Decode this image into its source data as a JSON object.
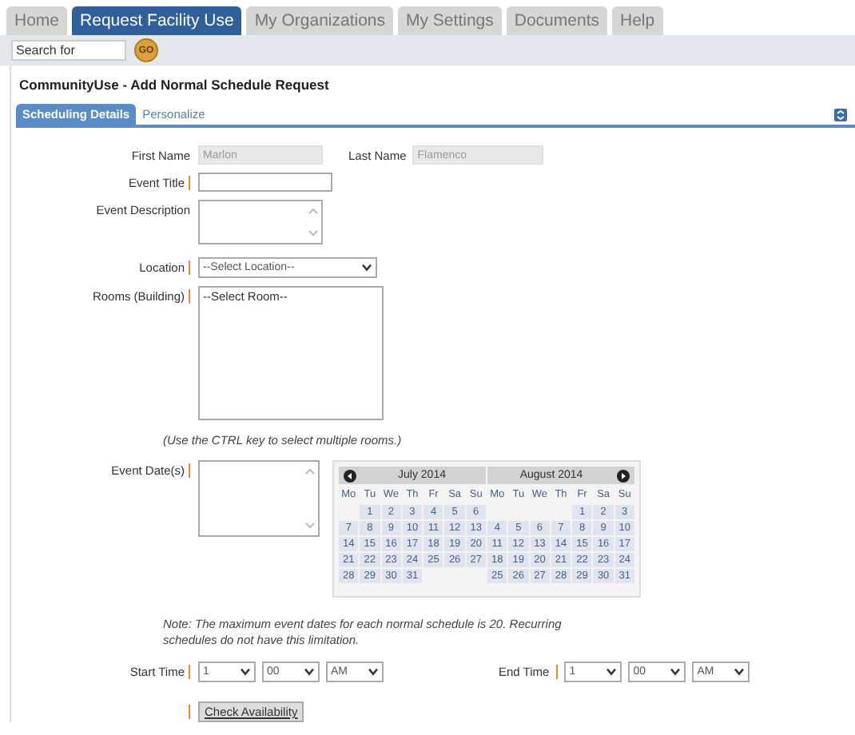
{
  "nav_tabs": [
    {
      "label": "Home",
      "selected": false
    },
    {
      "label": "Request Facility Use",
      "selected": true
    },
    {
      "label": "My Organizations",
      "selected": false
    },
    {
      "label": "My Settings",
      "selected": false
    },
    {
      "label": "Documents",
      "selected": false
    },
    {
      "label": "Help",
      "selected": false
    }
  ],
  "search": {
    "placeholder": "Search for",
    "button": "GO"
  },
  "page_title": "CommunityUse - Add Normal Schedule Request",
  "sub_tabs": [
    {
      "label": "Scheduling Details",
      "selected": true
    },
    {
      "label": "Personalize",
      "selected": false
    }
  ],
  "first_name": {
    "label": "First Name",
    "value": "Marlon",
    "disabled": true
  },
  "last_name": {
    "label": "Last Name",
    "value": "Flamenco",
    "disabled": true
  },
  "event_title": {
    "label": "Event Title",
    "required": true
  },
  "event_description": {
    "label": "Event Description",
    "required": false
  },
  "location": {
    "label": "Location",
    "required": true,
    "value": "--Select Location--"
  },
  "rooms": {
    "label": "Rooms (Building)",
    "required": true,
    "options": [
      "--Select Room--"
    ]
  },
  "rooms_hint": "(Use the CTRL key to select multiple rooms.)",
  "event_dates": {
    "label": "Event Date(s)",
    "required": true
  },
  "calendar": [
    {
      "title": "July 2014",
      "weekdays": [
        "Mo",
        "Tu",
        "We",
        "Th",
        "Fr",
        "Sa",
        "Su"
      ],
      "weeks": [
        [
          "1",
          "2",
          "3",
          "4",
          "5",
          "6"
        ],
        [
          "7",
          "8",
          "9",
          "10",
          "11",
          "12",
          "13"
        ],
        [
          "14",
          "15",
          "16",
          "17",
          "18",
          "19",
          "20"
        ],
        [
          "21",
          "22",
          "23",
          "24",
          "25",
          "26",
          "27"
        ],
        [
          "28",
          "29",
          "30",
          "31"
        ]
      ]
    },
    {
      "title": "August  2014",
      "weekdays": [
        "Mo",
        "Tu",
        "We",
        "Th",
        "Fr",
        "Sa",
        "Su"
      ],
      "weeks": [
        [
          "1",
          "2",
          "3"
        ],
        [
          "4",
          "5",
          "6",
          "7",
          "8",
          "9",
          "10"
        ],
        [
          "11",
          "12",
          "13",
          "14",
          "15",
          "16",
          "17"
        ],
        [
          "18",
          "19",
          "20",
          "21",
          "22",
          "23",
          "24"
        ],
        [
          "25",
          "26",
          "27",
          "28",
          "29",
          "30",
          "31"
        ]
      ]
    }
  ],
  "note": "Note: The maximum event dates for each normal schedule is 20. Recurring schedules do not have this limitation.",
  "start_time": {
    "label": "Start Time",
    "required": true,
    "hour": "1",
    "minute": "00",
    "ampm": "AM"
  },
  "end_time": {
    "label": "End Time",
    "required": true,
    "hour": "1",
    "minute": "00",
    "ampm": "AM"
  },
  "check_button": {
    "label": "Check Availability",
    "required": true
  }
}
